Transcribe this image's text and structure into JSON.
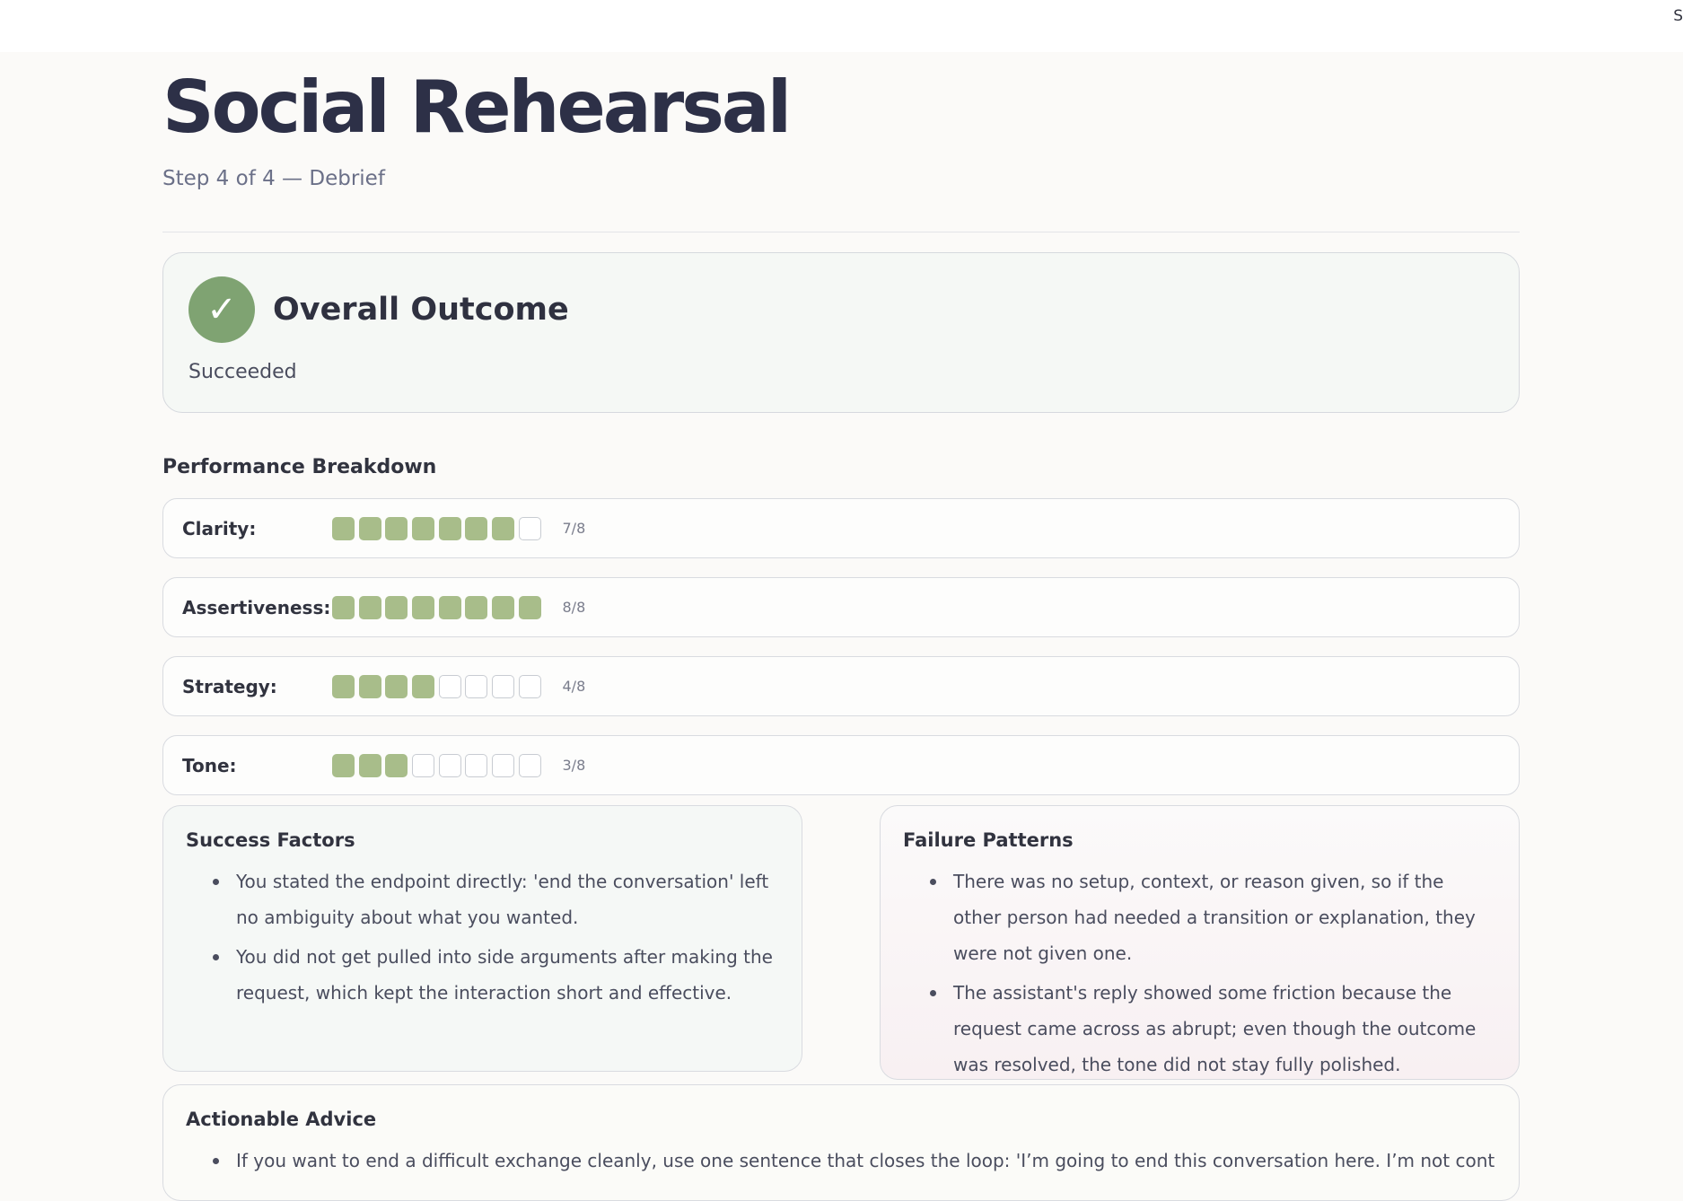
{
  "topbar": {
    "edge_text": "S"
  },
  "header": {
    "title": "Social Rehearsal",
    "subtitle": "Step 4 of 4 — Debrief"
  },
  "outcome": {
    "icon": "check-icon",
    "icon_glyph": "✓",
    "title": "Overall Outcome",
    "status": "Succeeded"
  },
  "performance": {
    "label": "Performance Breakdown",
    "metrics": [
      {
        "name": "Clarity:",
        "score": 7,
        "max": 8,
        "score_label": "7/8"
      },
      {
        "name": "Assertiveness:",
        "score": 8,
        "max": 8,
        "score_label": "8/8"
      },
      {
        "name": "Strategy:",
        "score": 4,
        "max": 8,
        "score_label": "4/8"
      },
      {
        "name": "Tone:",
        "score": 3,
        "max": 8,
        "score_label": "3/8"
      }
    ]
  },
  "success": {
    "title": "Success Factors",
    "items": [
      "You stated the endpoint directly: 'end the conversation' left no ambiguity about what you wanted.",
      "You did not get pulled into side arguments after making the request, which kept the interaction short and effective."
    ]
  },
  "failure": {
    "title": "Failure Patterns",
    "items": [
      "There was no setup, context, or reason given, so if the other person had needed a transition or explanation, they were not given one.",
      "The assistant's reply showed some friction because the request came across as abrupt; even though the outcome was resolved, the tone did not stay fully polished."
    ]
  },
  "advice": {
    "title": "Actionable Advice",
    "items": [
      "If you want to end a difficult exchange cleanly, use one sentence that closes the loop: 'I’m going to end this conversation here. I’m not continuing it right"
    ]
  },
  "colors": {
    "accent": "#7fa372",
    "filled_square": "#a8bd8a",
    "title": "#2d3047"
  }
}
